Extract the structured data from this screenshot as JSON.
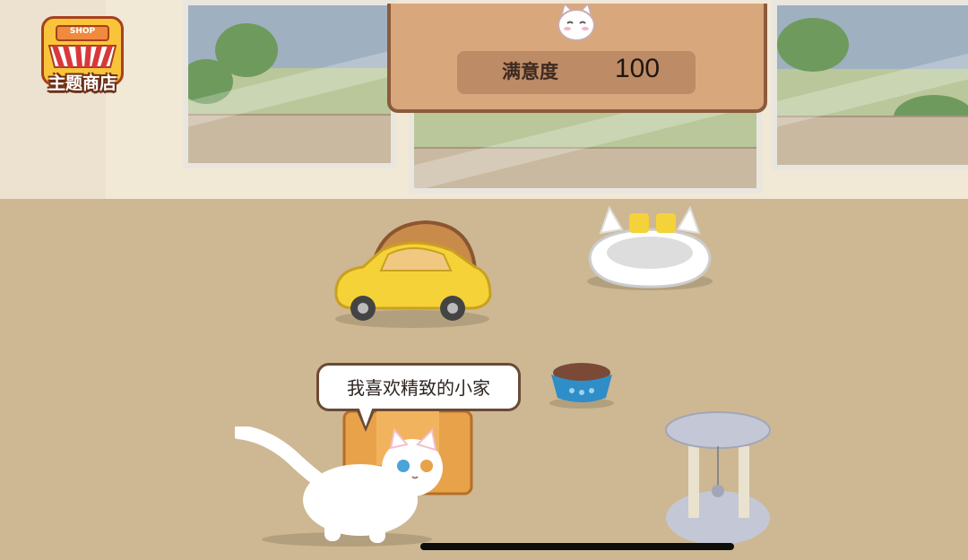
{
  "shop_button": {
    "sign_text": "SHOP",
    "label": "主题商店",
    "icon": "shop-awning-icon"
  },
  "satisfaction": {
    "label": "满意度",
    "value": "100",
    "icon": "cat-face-icon"
  },
  "speech_bubble": {
    "text": "我喜欢精致的小家"
  },
  "scene_items": [
    "cat",
    "toy-car",
    "cat-bed",
    "food-bowl",
    "cardboard-box",
    "cat-tree"
  ]
}
